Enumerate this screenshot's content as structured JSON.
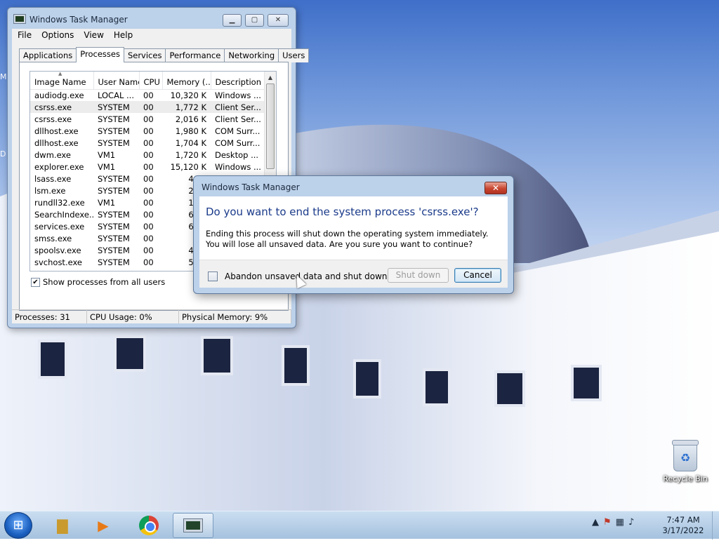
{
  "desktop": {
    "edge_letters": [
      "M",
      "D"
    ],
    "recycle_bin_label": "Recycle Bin"
  },
  "task_manager": {
    "title": "Windows Task Manager",
    "menu": [
      "File",
      "Options",
      "View",
      "Help"
    ],
    "tabs": [
      "Applications",
      "Processes",
      "Services",
      "Performance",
      "Networking",
      "Users"
    ],
    "active_tab": "Processes",
    "columns": [
      "Image Name",
      "User Name",
      "CPU",
      "Memory (...",
      "Description"
    ],
    "processes": [
      {
        "name": "audiodg.exe",
        "user": "LOCAL ...",
        "cpu": "00",
        "mem": "10,320 K",
        "desc": "Windows ..."
      },
      {
        "name": "csrss.exe",
        "user": "SYSTEM",
        "cpu": "00",
        "mem": "1,772 K",
        "desc": "Client Ser..."
      },
      {
        "name": "csrss.exe",
        "user": "SYSTEM",
        "cpu": "00",
        "mem": "2,016 K",
        "desc": "Client Ser..."
      },
      {
        "name": "dllhost.exe",
        "user": "SYSTEM",
        "cpu": "00",
        "mem": "1,980 K",
        "desc": "COM Surr..."
      },
      {
        "name": "dllhost.exe",
        "user": "SYSTEM",
        "cpu": "00",
        "mem": "1,704 K",
        "desc": "COM Surr..."
      },
      {
        "name": "dwm.exe",
        "user": "VM1",
        "cpu": "00",
        "mem": "1,720 K",
        "desc": "Desktop ..."
      },
      {
        "name": "explorer.exe",
        "user": "VM1",
        "cpu": "00",
        "mem": "15,120 K",
        "desc": "Windows ..."
      },
      {
        "name": "lsass.exe",
        "user": "SYSTEM",
        "cpu": "00",
        "mem": "4,70",
        "desc": ""
      },
      {
        "name": "lsm.exe",
        "user": "SYSTEM",
        "cpu": "00",
        "mem": "2,06",
        "desc": ""
      },
      {
        "name": "rundll32.exe",
        "user": "VM1",
        "cpu": "00",
        "mem": "1,77",
        "desc": ""
      },
      {
        "name": "SearchIndexe...",
        "user": "SYSTEM",
        "cpu": "00",
        "mem": "6,40",
        "desc": ""
      },
      {
        "name": "services.exe",
        "user": "SYSTEM",
        "cpu": "00",
        "mem": "6,17",
        "desc": ""
      },
      {
        "name": "smss.exe",
        "user": "SYSTEM",
        "cpu": "00",
        "mem": "48",
        "desc": ""
      },
      {
        "name": "spoolsv.exe",
        "user": "SYSTEM",
        "cpu": "00",
        "mem": "4,71",
        "desc": ""
      },
      {
        "name": "svchost.exe",
        "user": "SYSTEM",
        "cpu": "00",
        "mem": "5,85",
        "desc": ""
      }
    ],
    "selected_row_index": 1,
    "show_all_label": "Show processes from all users",
    "show_all_checked": true,
    "status": {
      "processes": "Processes: 31",
      "cpu": "CPU Usage: 0%",
      "memory": "Physical Memory: 9%"
    }
  },
  "dialog": {
    "title": "Windows Task Manager",
    "heading": "Do you want to end the system process 'csrss.exe'?",
    "body": "Ending this process will shut down the operating system immediately.  You will lose all unsaved data.  Are you sure you want to continue?",
    "checkbox_label": "Abandon unsaved data and shut down.",
    "checkbox_checked": false,
    "shutdown_label": "Shut down",
    "cancel_label": "Cancel",
    "close_glyph": "✕"
  },
  "taskbar": {
    "items": [
      "start-button",
      "windows-explorer",
      "media-player",
      "google-chrome",
      "task-manager"
    ],
    "active_item": "task-manager",
    "tray_icons": [
      "show-hidden-icons",
      "action-center-icon",
      "network-icon",
      "volume-icon"
    ],
    "time": "7:47 AM",
    "date": "3/17/2022"
  },
  "colors": {
    "dialog_heading": "#1a3a8a",
    "close_button": "#c8452f",
    "window_frame": "#bcd1ea"
  }
}
